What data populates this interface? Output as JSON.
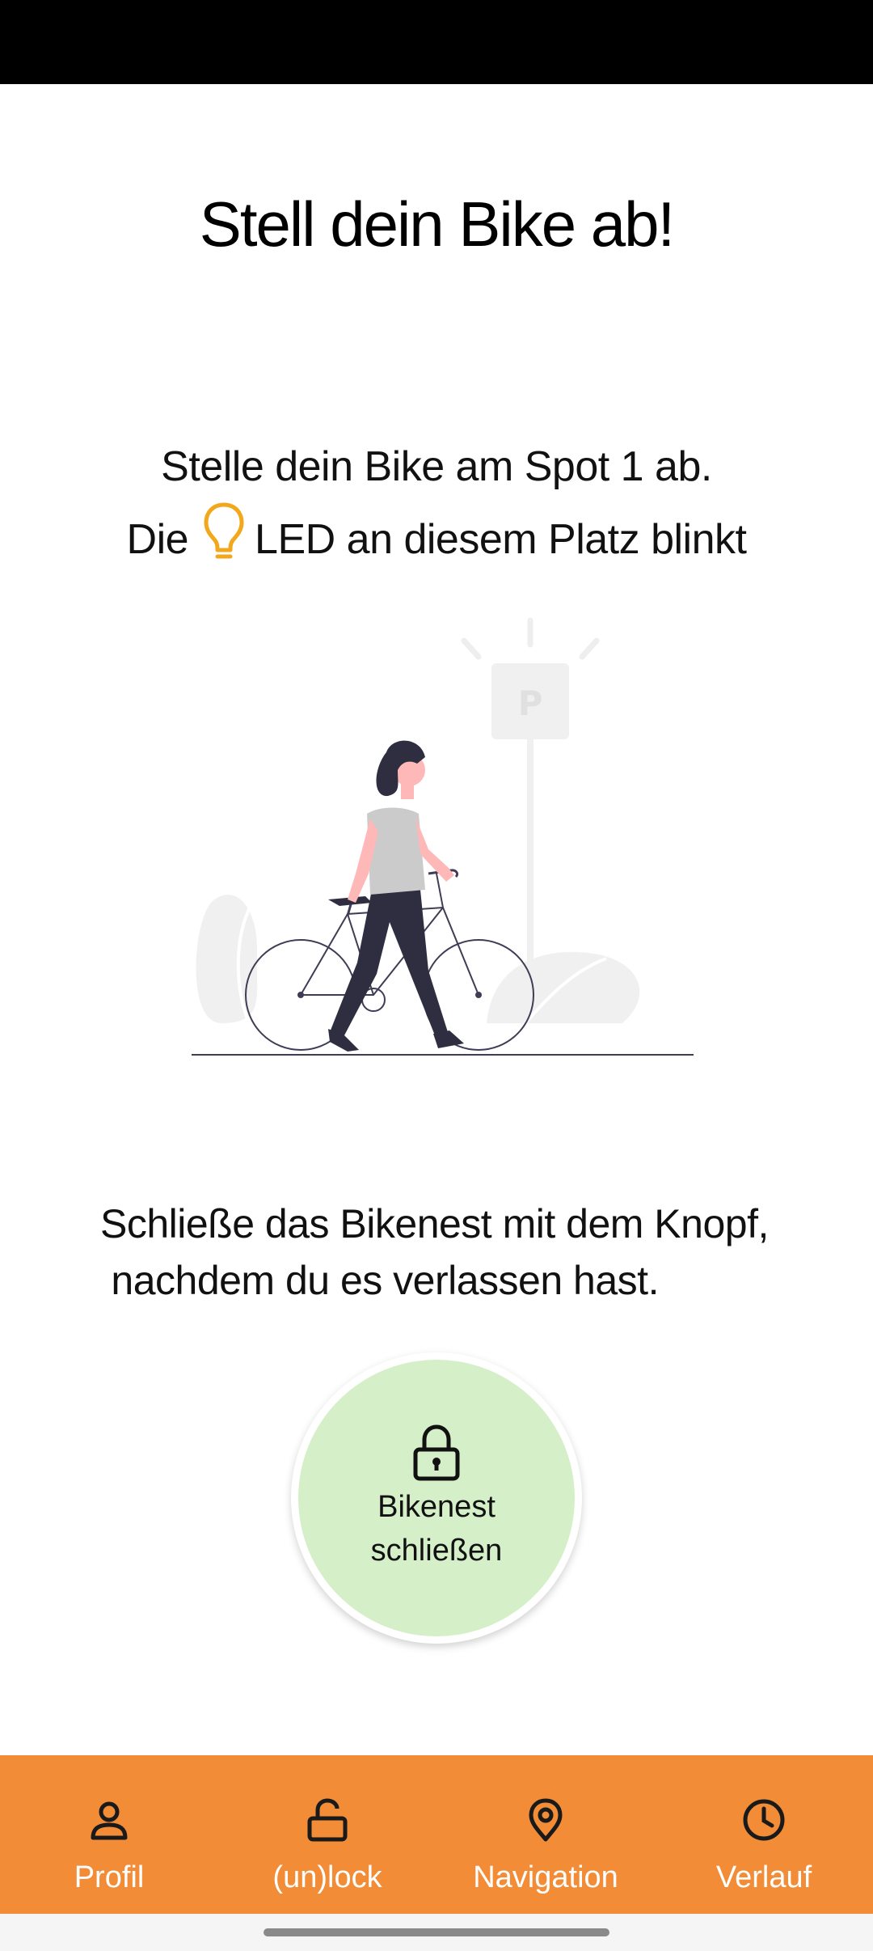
{
  "page": {
    "title": "Stell dein Bike ab!",
    "instruction_line1": "Stelle dein Bike am Spot 1 ab.",
    "instruction_line2_prefix": "Die",
    "instruction_line2_suffix": "LED an diesem Platz blinkt",
    "led_icon": "lightbulb-icon",
    "led_color": "#f2a81d",
    "parking_sign_label": "P",
    "close_hint": "Schließe das Bikenest mit dem Knopf,\n nachdem du es verlassen hast."
  },
  "lock_button": {
    "label": "Bikenest schließen",
    "icon": "lock-icon",
    "color": "#d5f0c8"
  },
  "bottom_nav": {
    "background": "#f28c36",
    "items": [
      {
        "label": "Profil",
        "icon": "user-icon"
      },
      {
        "label": "(un)lock",
        "icon": "unlock-icon"
      },
      {
        "label": "Navigation",
        "icon": "map-pin-icon"
      },
      {
        "label": "Verlauf",
        "icon": "clock-icon"
      }
    ]
  }
}
